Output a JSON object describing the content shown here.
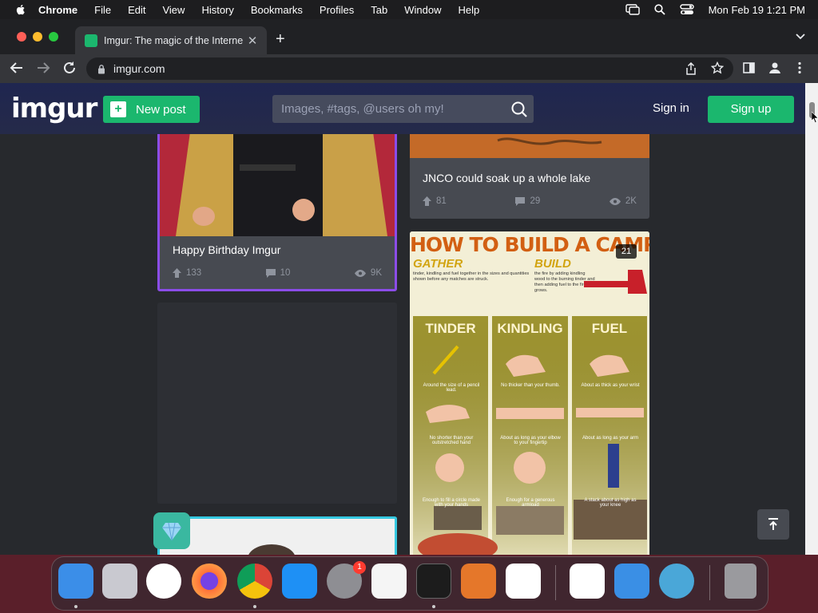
{
  "menubar": {
    "app": "Chrome",
    "items": [
      "File",
      "Edit",
      "View",
      "History",
      "Bookmarks",
      "Profiles",
      "Tab",
      "Window",
      "Help"
    ],
    "datetime": "Mon Feb 19  1:21 PM"
  },
  "browser": {
    "tab_title": "Imgur: The magic of the Interne",
    "url": "imgur.com"
  },
  "imgur": {
    "logo": "imgur",
    "new_post": "New post",
    "search_placeholder": "Images, #tags, @users oh my!",
    "sign_in": "Sign in",
    "sign_up": "Sign up"
  },
  "posts": [
    {
      "title": "Happy Birthday Imgur",
      "upvotes": "133",
      "comments": "10",
      "views": "9K"
    },
    {
      "title": "JNCO could soak up a whole lake",
      "upvotes": "81",
      "comments": "29",
      "views": "2K"
    }
  ],
  "campfire": {
    "count_badge": "21",
    "heading": "HOW TO BUILD A CAMPFIRE",
    "gather": "GATHER",
    "build": "BUILD",
    "gather_text": "tinder, kindling and fuel together in the sizes and quantities shown before any matches are struck.",
    "build_text": "the fire by adding kindling wood to the burning tinder and then adding fuel to the fire as it grows.",
    "columns": [
      "TINDER",
      "KINDLING",
      "FUEL"
    ],
    "size_notes": [
      "Around the size of a pencil lead.",
      "No thicker than your thumb.",
      "About as thick as your wrist"
    ],
    "length_notes": [
      "No shorter than your outstretched hand",
      "About as long as your elbow to your fingertip",
      "About as long as your arm"
    ],
    "amount_notes": [
      "Enough to fill a circle made with your hands",
      "Enough for a generous armload",
      "A stack about as high as your knee"
    ]
  },
  "colors": {
    "green": "#1bb76e",
    "header": "#1f2650",
    "card": "#474a51",
    "page": "#27292d"
  },
  "dock_apps": [
    "finder-icon",
    "launchpad-icon",
    "safari-icon",
    "firefox-icon",
    "chrome-icon",
    "app-store-icon",
    "system-settings-icon",
    "textedit-icon",
    "terminal-icon",
    "garageband-icon",
    "vscode-icon",
    "visual-studio-icon",
    "weather-icon",
    "proxyman-icon",
    "trash-icon"
  ],
  "dock_badge": "1"
}
